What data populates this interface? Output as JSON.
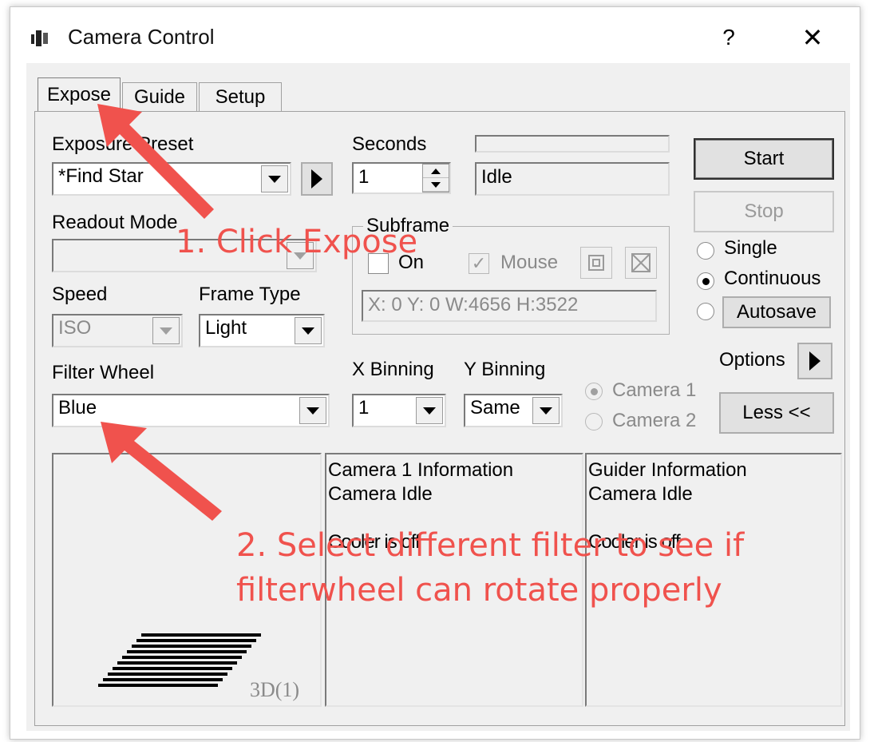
{
  "window": {
    "title": "Camera Control",
    "help": "?",
    "close": "✕"
  },
  "tabs": [
    {
      "label": "Expose"
    },
    {
      "label": "Guide"
    },
    {
      "label": "Setup"
    }
  ],
  "expose": {
    "exposure_preset": {
      "label": "Exposure Preset",
      "value": "*Find Star"
    },
    "seconds": {
      "label": "Seconds",
      "value": "1"
    },
    "status": "Idle",
    "readout_mode": {
      "label": "Readout Mode",
      "value": ""
    },
    "speed": {
      "label": "Speed",
      "value": "ISO"
    },
    "frame_type": {
      "label": "Frame Type",
      "value": "Light"
    },
    "filter_wheel": {
      "label": "Filter Wheel",
      "value": "Blue"
    },
    "subframe": {
      "title": "Subframe",
      "on_label": "On",
      "mouse_label": "Mouse",
      "coords": "X:   0 Y:   0 W:4656 H:3522"
    },
    "x_binning": {
      "label": "X Binning",
      "value": "1"
    },
    "y_binning": {
      "label": "Y Binning",
      "value": "Same"
    },
    "camera1_label": "Camera 1",
    "camera2_label": "Camera 2",
    "buttons": {
      "start": "Start",
      "stop": "Stop",
      "options": "Options",
      "less": "Less <<",
      "autosave": "Autosave"
    },
    "modes": {
      "single": "Single",
      "continuous": "Continuous"
    }
  },
  "preview": {
    "label": "3D(1)"
  },
  "info": {
    "camera": {
      "title": "Camera 1 Information",
      "status": "Camera Idle",
      "cooler": "Cooler is off"
    },
    "guider": {
      "title": "Guider Information",
      "status": "Camera Idle",
      "cooler": "Cooler is off"
    }
  },
  "annotations": {
    "step1": "1. Click Expose",
    "step2_line1": "2. Select different filter to see if",
    "step2_line2": "filterwheel can rotate properly",
    "color": "#f0524d"
  }
}
